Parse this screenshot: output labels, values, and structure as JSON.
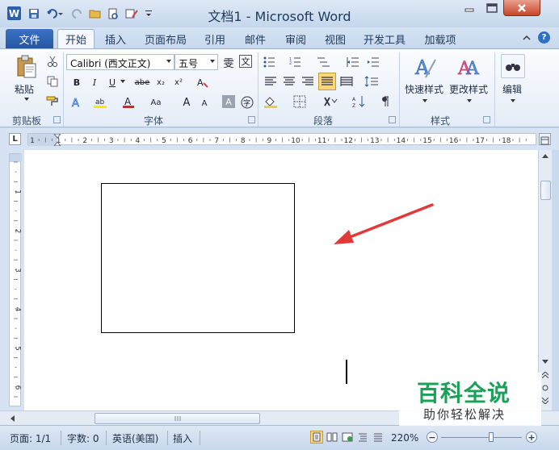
{
  "window": {
    "title": "文档1 - Microsoft Word",
    "logo_letter": "W"
  },
  "tabs": {
    "file": "文件",
    "items": [
      "开始",
      "插入",
      "页面布局",
      "引用",
      "邮件",
      "审阅",
      "视图",
      "开发工具",
      "加载项"
    ],
    "active": "开始"
  },
  "ribbon": {
    "clipboard": {
      "group_label": "剪贴板",
      "paste_label": "粘贴"
    },
    "font": {
      "group_label": "字体",
      "font_name": "Calibri (西文正文)",
      "font_size": "五号",
      "bold": "B",
      "italic": "I",
      "underline": "U",
      "strike": "abe",
      "subscript": "x₂",
      "superscript": "x²",
      "grow": "A",
      "shrink": "A",
      "case": "Aa",
      "clear": "A",
      "char_border": "A",
      "wen": "雯",
      "pinyin": "文"
    },
    "paragraph": {
      "group_label": "段落"
    },
    "styles": {
      "group_label": "样式",
      "quick_styles": "快速样式",
      "change_styles": "更改样式"
    },
    "editing": {
      "label": "编辑"
    }
  },
  "ruler": {
    "corner": "L",
    "h_numbers": [
      "1",
      "1",
      "2",
      "3",
      "4",
      "5",
      "6",
      "7",
      "8",
      "9",
      "10",
      "11",
      "12",
      "13",
      "14",
      "15",
      "16",
      "17",
      "18"
    ],
    "v_numbers": [
      "1",
      "2",
      "3",
      "4",
      "5",
      "6"
    ]
  },
  "statusbar": {
    "page": "页面: 1/1",
    "words": "字数: 0",
    "language": "英语(美国)",
    "mode": "插入",
    "zoom": "220%",
    "zoom_out": "−",
    "zoom_in": "+"
  },
  "watermark": {
    "title": "百科全说",
    "subtitle": "助你轻松解决"
  },
  "colors": {
    "accent": "#2b5fb0",
    "arrow": "#e03a3a",
    "watermark_green": "#1aa158"
  }
}
